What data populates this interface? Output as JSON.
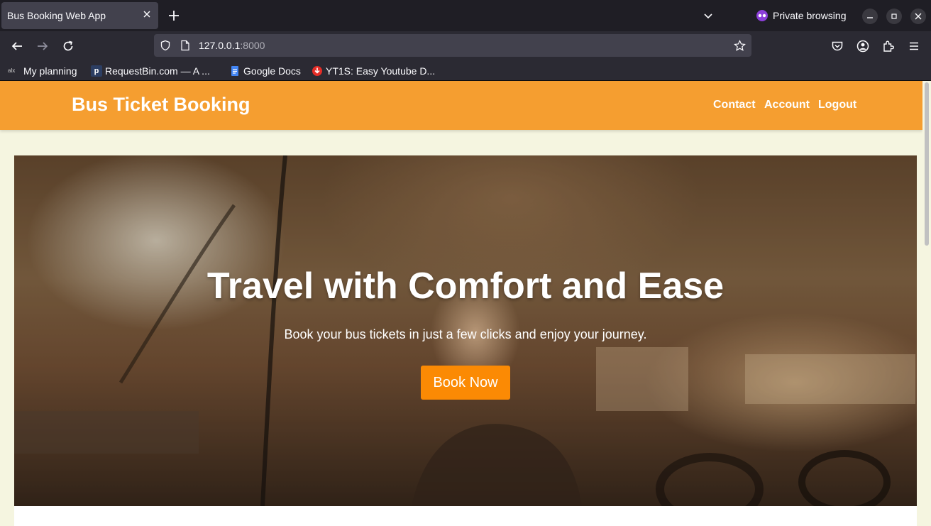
{
  "browser": {
    "tab_title": "Bus Booking Web App",
    "private_label": "Private browsing",
    "url_host": "127.0.0.1",
    "url_port": ":8000",
    "bookmarks": [
      {
        "label": "My planning",
        "icon": "alx-icon"
      },
      {
        "label": "RequestBin.com — A ...",
        "icon": "p-icon"
      },
      {
        "label": "Google Docs",
        "icon": "docs-icon"
      },
      {
        "label": "YT1S: Easy Youtube D...",
        "icon": "download-icon"
      }
    ]
  },
  "header": {
    "brand": "Bus Ticket Booking",
    "nav": [
      "Contact",
      "Account",
      "Logout"
    ]
  },
  "hero": {
    "title": "Travel with Comfort and Ease",
    "subtitle": "Book your bus tickets in just a few clicks and enjoy your journey.",
    "cta": "Book Now"
  },
  "colors": {
    "header_bg": "#f59e30",
    "cta_bg": "#fb8a04",
    "page_bg": "#f5f5e0"
  }
}
